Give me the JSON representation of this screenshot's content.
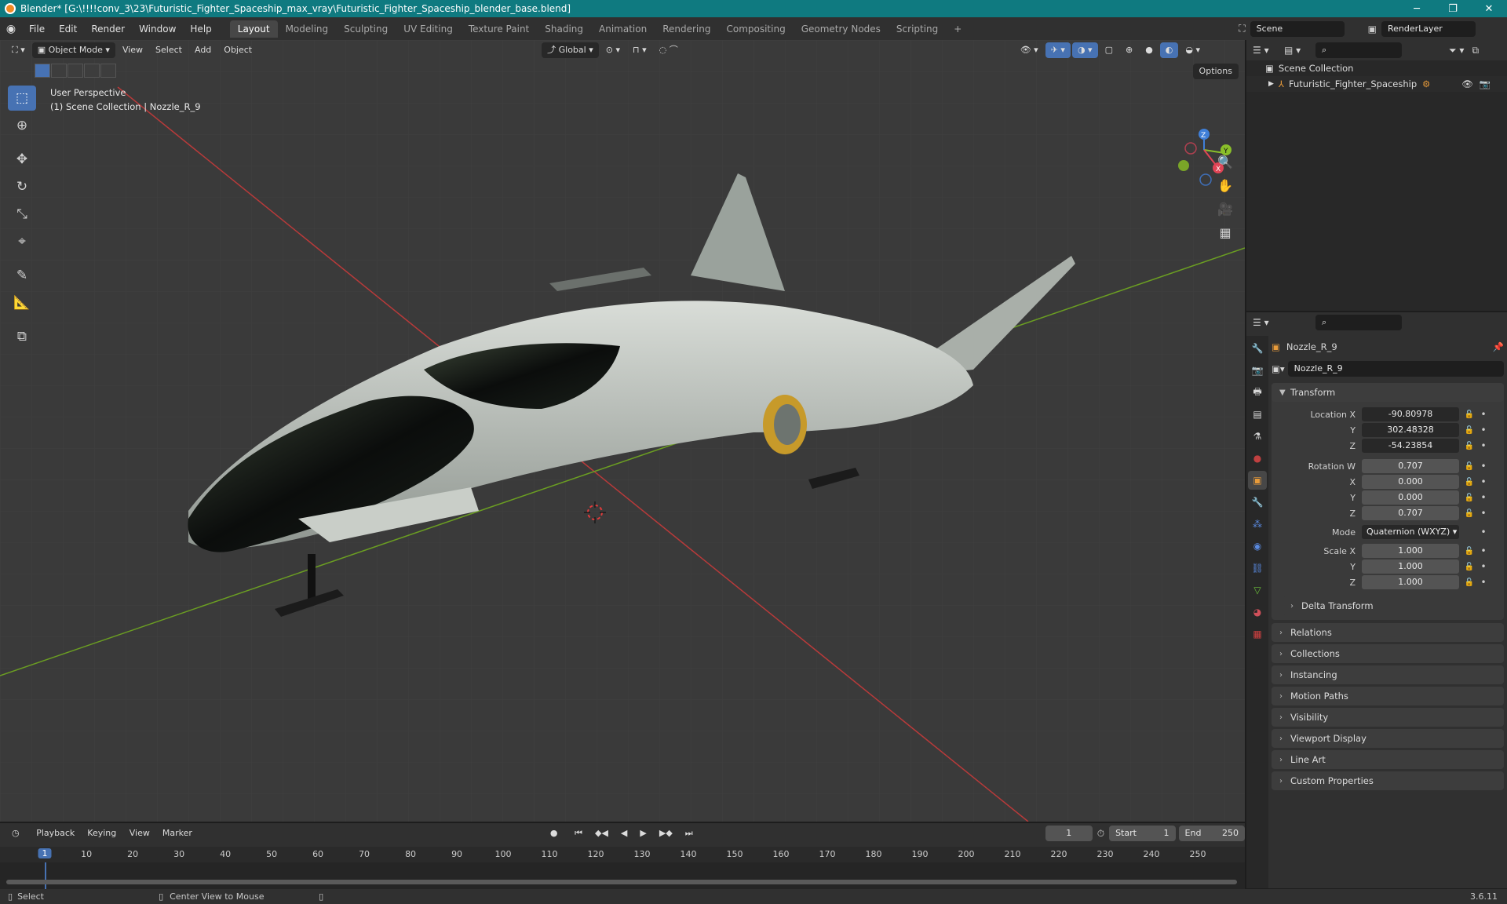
{
  "window": {
    "title": "Blender* [G:\\!!!!conv_3\\23\\Futuristic_Fighter_Spaceship_max_vray\\Futuristic_Fighter_Spaceship_blender_base.blend]",
    "minimize": "─",
    "maximize": "❐",
    "close": "✕"
  },
  "menubar": {
    "items": [
      "File",
      "Edit",
      "Render",
      "Window",
      "Help"
    ],
    "workspaces": [
      "Layout",
      "Modeling",
      "Sculpting",
      "UV Editing",
      "Texture Paint",
      "Shading",
      "Animation",
      "Rendering",
      "Compositing",
      "Geometry Nodes",
      "Scripting"
    ],
    "add_tab": "+",
    "scene": "Scene",
    "render_layer": "RenderLayer"
  },
  "viewport": {
    "mode": "Object Mode",
    "menus": [
      "View",
      "Select",
      "Add",
      "Object"
    ],
    "orientation": "Global",
    "options": "Options",
    "info_line1": "User Perspective",
    "info_line2": "(1) Scene Collection | Nozzle_R_9",
    "gizmo": {
      "x": "X",
      "y": "Y",
      "z": "Z"
    }
  },
  "outliner": {
    "root": "Scene Collection",
    "child": "Futuristic_Fighter_Spaceship"
  },
  "properties": {
    "object_name": "Nozzle_R_9",
    "data_name": "Nozzle_R_9",
    "transform_label": "Transform",
    "location_label": "Location X",
    "location": [
      "-90.80978",
      "302.48328",
      "-54.23854"
    ],
    "rotation_label": "Rotation W",
    "rotation": [
      "0.707",
      "0.000",
      "0.000",
      "0.707"
    ],
    "mode_label": "Mode",
    "mode_value": "Quaternion (WXYZ)",
    "scale_label": "Scale X",
    "scale": [
      "1.000",
      "1.000",
      "1.000"
    ],
    "axis_y": "Y",
    "axis_z": "Z",
    "axis_x": "X",
    "delta_transform": "Delta Transform",
    "panels": [
      "Relations",
      "Collections",
      "Instancing",
      "Motion Paths",
      "Visibility",
      "Viewport Display",
      "Line Art",
      "Custom Properties"
    ]
  },
  "timeline": {
    "menus": [
      "Playback",
      "Keying",
      "View",
      "Marker"
    ],
    "current_frame": "1",
    "start_label": "Start",
    "start": "1",
    "end_label": "End",
    "end": "250",
    "ticks": [
      "10",
      "20",
      "30",
      "40",
      "50",
      "60",
      "70",
      "80",
      "90",
      "100",
      "110",
      "120",
      "130",
      "140",
      "150",
      "160",
      "170",
      "180",
      "190",
      "200",
      "210",
      "220",
      "230",
      "240",
      "250"
    ],
    "playhead": "1"
  },
  "statusbar": {
    "select": "Select",
    "center": "Center View to Mouse",
    "version": "3.6.11"
  },
  "colors": {
    "accent": "#4772b3",
    "titlebar": "#0f7a80",
    "x_axis": "#b83a3a",
    "y_axis": "#6b9e22"
  }
}
